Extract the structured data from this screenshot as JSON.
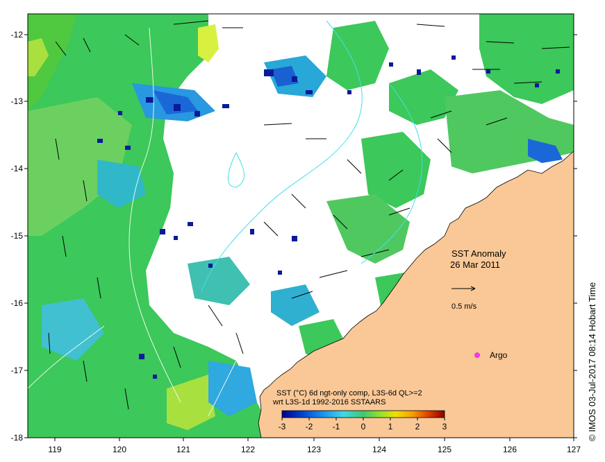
{
  "map": {
    "title_lines": [
      "SST Anomaly",
      "26 Mar 2011"
    ],
    "longitude_ticks": [
      "119",
      "120",
      "121",
      "122",
      "123",
      "124",
      "125",
      "126",
      "127"
    ],
    "latitude_ticks": [
      "-12",
      "-13",
      "-14",
      "-15",
      "-16",
      "-17",
      "-18"
    ],
    "reference_vector_label": "0.5 m/s",
    "argo_label": "Argo",
    "argo_color": "#ff33ff",
    "land_color": "#f9c896",
    "legend": {
      "line1": "SST (°C) 6d ngt-only comp, L3S-6d QL>=2",
      "line2": "wrt L3S-1d 1992-2016 SSTAARS",
      "ticks": [
        "-3",
        "-2",
        "-1",
        "0",
        "1",
        "2",
        "3"
      ],
      "colors": [
        "#00008b",
        "#0050d8",
        "#30a8f0",
        "#40e0c0",
        "#40c840",
        "#a8e020",
        "#f0e000",
        "#f8a000",
        "#e05000",
        "#8b0000"
      ]
    },
    "credit": "© IMOS 03-Jul-2017 08:14 Hobart Time"
  }
}
